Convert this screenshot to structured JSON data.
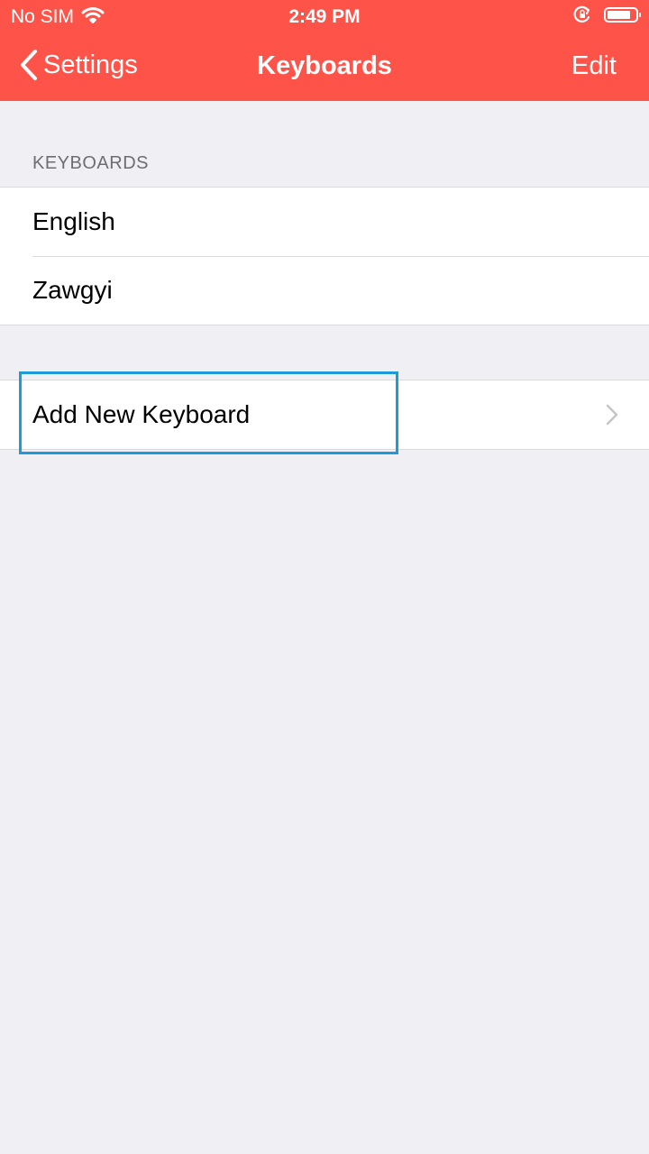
{
  "status_bar": {
    "carrier": "No SIM",
    "time": "2:49 PM",
    "icons": [
      "wifi-icon",
      "orientation-lock-icon",
      "battery-icon"
    ]
  },
  "nav": {
    "back_label": "Settings",
    "title": "Keyboards",
    "edit_label": "Edit"
  },
  "keyboards_section": {
    "header": "KEYBOARDS",
    "items": [
      "English",
      "Zawgyi"
    ]
  },
  "add_keyboard": {
    "label": "Add New Keyboard"
  },
  "colors": {
    "accent": "#fe5349",
    "background": "#efeff4",
    "highlight": "#1d9bd8"
  }
}
